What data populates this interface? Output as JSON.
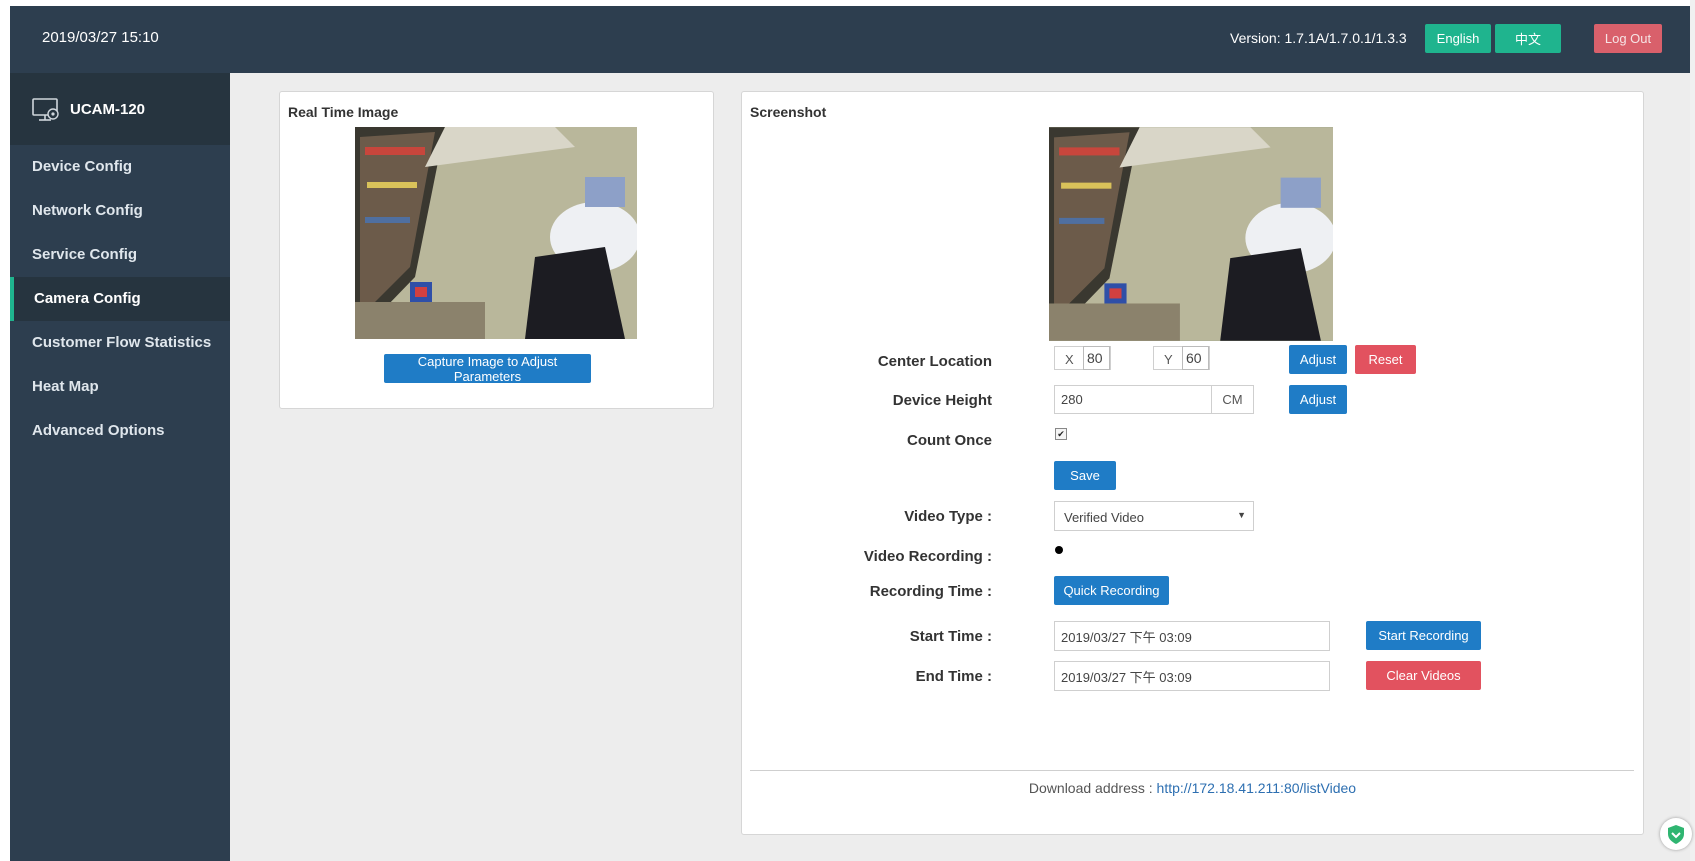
{
  "header": {
    "datetime": "2019/03/27 15:10",
    "version": "Version: 1.7.1A/1.7.0.1/1.3.3",
    "english_label": "English",
    "chinese_label": "中文",
    "logout_label": "Log Out"
  },
  "sidebar": {
    "device_name": "UCAM-120",
    "items": [
      {
        "label": "Device Config"
      },
      {
        "label": "Network Config"
      },
      {
        "label": "Service Config"
      },
      {
        "label": "Camera Config",
        "active": true
      },
      {
        "label": "Customer Flow Statistics"
      },
      {
        "label": "Heat Map"
      },
      {
        "label": "Advanced Options"
      }
    ]
  },
  "realtime": {
    "title": "Real Time Image",
    "capture_label": "Capture Image to Adjust Parameters"
  },
  "screenshot": {
    "title": "Screenshot",
    "center_location_label": "Center Location",
    "x_label": "X",
    "x_value": "80",
    "y_label": "Y",
    "y_value": "60",
    "adjust_label": "Adjust",
    "reset_label": "Reset",
    "device_height_label": "Device Height",
    "device_height_value": "280",
    "unit": "CM",
    "count_once_label": "Count Once",
    "count_once_checked": true,
    "save_label": "Save",
    "video_type_label": "Video Type :",
    "video_type_value": "Verified Video",
    "video_recording_label": "Video Recording :",
    "recording_time_label": "Recording Time :",
    "quick_recording_label": "Quick Recording",
    "start_time_label": "Start Time :",
    "start_time_value": "2019/03/27 下午 03:09",
    "start_recording_label": "Start Recording",
    "end_time_label": "End Time :",
    "end_time_value": "2019/03/27 下午 03:09",
    "clear_videos_label": "Clear Videos",
    "download_prefix": "Download address : ",
    "download_link": "http://172.18.41.211:80/listVideo"
  },
  "colors": {
    "header_bg": "#2d3e4f",
    "accent_green": "#1fb48e",
    "primary_blue": "#1f7cc6",
    "danger_red": "#e2525f"
  }
}
